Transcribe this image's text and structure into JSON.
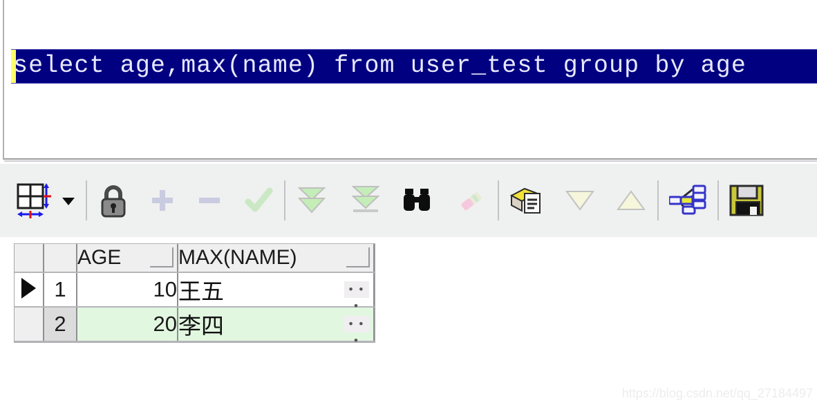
{
  "editor": {
    "sql_text": "select age,max(name) from user_test group by age",
    "selection_color": "#000080",
    "selection_text_color": "#e8e8ff",
    "caret_color": "#ffff66"
  },
  "toolbar": {
    "background": "#eff0f0",
    "items": [
      {
        "name": "grid-layout-icon",
        "label": "Grid layout",
        "enabled": true,
        "kind": "grid"
      },
      {
        "name": "chevron-down-icon",
        "label": "Grid layout options",
        "enabled": true,
        "kind": "caret"
      },
      {
        "name": "separator",
        "label": "",
        "enabled": false,
        "kind": "sep"
      },
      {
        "name": "lock-icon",
        "label": "Lock record",
        "enabled": true,
        "kind": "lock"
      },
      {
        "name": "plus-icon",
        "label": "Insert record",
        "enabled": false,
        "kind": "plus"
      },
      {
        "name": "minus-icon",
        "label": "Delete record",
        "enabled": false,
        "kind": "minus"
      },
      {
        "name": "check-icon",
        "label": "Post changes",
        "enabled": false,
        "kind": "check"
      },
      {
        "name": "separator",
        "label": "",
        "enabled": false,
        "kind": "sep"
      },
      {
        "name": "fetch-next-page-icon",
        "label": "Fetch next page",
        "enabled": true,
        "kind": "dblarrow"
      },
      {
        "name": "fetch-last-page-icon",
        "label": "Fetch last page",
        "enabled": true,
        "kind": "dblarrowbar"
      },
      {
        "name": "find-icon",
        "label": "Find",
        "enabled": true,
        "kind": "binoculars"
      },
      {
        "name": "eraser-icon",
        "label": "Clear",
        "enabled": false,
        "kind": "eraser"
      },
      {
        "name": "separator",
        "label": "",
        "enabled": false,
        "kind": "sep"
      },
      {
        "name": "copy-to-notes-icon",
        "label": "Copy to clipboard",
        "enabled": true,
        "kind": "notes"
      },
      {
        "name": "sort-descending-icon",
        "label": "Sort descending",
        "enabled": false,
        "kind": "tri-down"
      },
      {
        "name": "sort-ascending-icon",
        "label": "Sort ascending",
        "enabled": false,
        "kind": "tri-up"
      },
      {
        "name": "separator",
        "label": "",
        "enabled": false,
        "kind": "sep"
      },
      {
        "name": "query-plan-icon",
        "label": "Explain plan",
        "enabled": true,
        "kind": "tree"
      },
      {
        "name": "separator",
        "label": "",
        "enabled": false,
        "kind": "sep"
      },
      {
        "name": "save-icon",
        "label": "Export results",
        "enabled": true,
        "kind": "floppy"
      }
    ]
  },
  "grid": {
    "columns": [
      "AGE",
      "MAX(NAME)"
    ],
    "rows": [
      {
        "num": "1",
        "age": "10",
        "name": "王五",
        "selected": true,
        "ellipsis": "• • •"
      },
      {
        "num": "2",
        "age": "20",
        "name": "李四",
        "selected": false,
        "ellipsis": "• • •"
      }
    ],
    "selected_row_marker": "▶",
    "alt_row_color": "#e2f7e0"
  },
  "watermark": {
    "text": "https://blog.csdn.net/qq_27184497"
  }
}
